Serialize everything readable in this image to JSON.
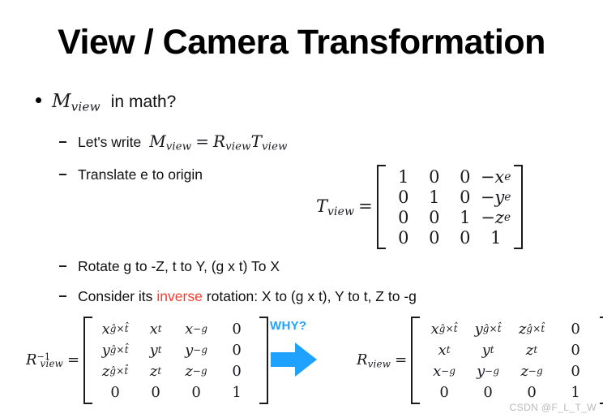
{
  "slide": {
    "title": "View / Camera Transformation",
    "background_color": "#ffffff",
    "accent_blue": "#1fa2ff",
    "highlight_red": "#fb3b30",
    "watermark": "CSDN @F_L_T_W"
  },
  "bullets": {
    "level1": {
      "math_symbol": "M",
      "math_subscript": "view",
      "text": "in math?"
    },
    "level2": [
      {
        "id": "lets-write",
        "prefix": "Let's write",
        "equation": {
          "lhs_symbol": "M",
          "lhs_subscript": "view",
          "operator": "=",
          "rhs": [
            {
              "symbol": "R",
              "subscript": "view"
            },
            {
              "symbol": "T",
              "subscript": "view"
            }
          ]
        }
      },
      {
        "id": "translate-e",
        "text": "Translate e to origin"
      },
      {
        "id": "rotate-g",
        "text": "Rotate g to -Z, t to Y, (g x t) To X"
      },
      {
        "id": "consider-inverse",
        "text_before": "Consider its",
        "highlight": "inverse",
        "text_after": "rotation: X to (g x t), Y to t, Z to -g"
      }
    ]
  },
  "equations": {
    "tview": {
      "lhs_symbol": "T",
      "lhs_subscript": "view",
      "operator": "=",
      "rows": [
        [
          {
            "base": "1"
          },
          {
            "base": "0"
          },
          {
            "base": "0"
          },
          {
            "base": "−x",
            "sub": "e",
            "italic": true
          }
        ],
        [
          {
            "base": "0"
          },
          {
            "base": "1"
          },
          {
            "base": "0"
          },
          {
            "base": "−y",
            "sub": "e",
            "italic": true
          }
        ],
        [
          {
            "base": "0"
          },
          {
            "base": "0"
          },
          {
            "base": "1"
          },
          {
            "base": "−z",
            "sub": "e",
            "italic": true
          }
        ],
        [
          {
            "base": "0"
          },
          {
            "base": "0"
          },
          {
            "base": "0"
          },
          {
            "base": "1"
          }
        ]
      ]
    },
    "rview_inverse": {
      "lhs_symbol": "R",
      "lhs_subscript": "view",
      "lhs_superscript": "−1",
      "operator": "=",
      "rows": [
        [
          {
            "base": "x",
            "sub": "ĝ×t̂",
            "italic": true
          },
          {
            "base": "x",
            "sub": "t",
            "italic": true
          },
          {
            "base": "x",
            "sub": "−g",
            "italic": true
          },
          {
            "base": "0"
          }
        ],
        [
          {
            "base": "y",
            "sub": "ĝ×t̂",
            "italic": true
          },
          {
            "base": "y",
            "sub": "t",
            "italic": true
          },
          {
            "base": "y",
            "sub": "−g",
            "italic": true
          },
          {
            "base": "0"
          }
        ],
        [
          {
            "base": "z",
            "sub": "ĝ×t̂",
            "italic": true
          },
          {
            "base": "z",
            "sub": "t",
            "italic": true
          },
          {
            "base": "z",
            "sub": "−g",
            "italic": true
          },
          {
            "base": "0"
          }
        ],
        [
          {
            "base": "0"
          },
          {
            "base": "0"
          },
          {
            "base": "0"
          },
          {
            "base": "1"
          }
        ]
      ]
    },
    "rview": {
      "lhs_symbol": "R",
      "lhs_subscript": "view",
      "operator": "=",
      "rows": [
        [
          {
            "base": "x",
            "sub": "ĝ×t̂",
            "italic": true
          },
          {
            "base": "y",
            "sub": "ĝ×t̂",
            "italic": true
          },
          {
            "base": "z",
            "sub": "ĝ×t̂",
            "italic": true
          },
          {
            "base": "0"
          }
        ],
        [
          {
            "base": "x",
            "sub": "t",
            "italic": true
          },
          {
            "base": "y",
            "sub": "t",
            "italic": true
          },
          {
            "base": "z",
            "sub": "t",
            "italic": true
          },
          {
            "base": "0"
          }
        ],
        [
          {
            "base": "x",
            "sub": "−g",
            "italic": true
          },
          {
            "base": "y",
            "sub": "−g",
            "italic": true
          },
          {
            "base": "z",
            "sub": "−g",
            "italic": true
          },
          {
            "base": "0"
          }
        ],
        [
          {
            "base": "0"
          },
          {
            "base": "0"
          },
          {
            "base": "0"
          },
          {
            "base": "1"
          }
        ]
      ]
    }
  },
  "annotation": {
    "why_label": "WHY?",
    "arrow_direction": "right",
    "arrow_color": "#1fa2ff"
  }
}
